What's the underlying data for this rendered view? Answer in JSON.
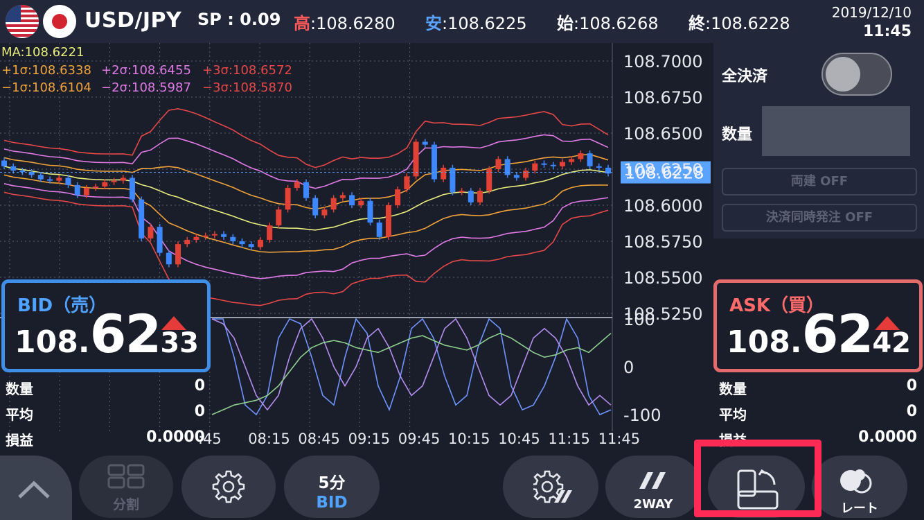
{
  "header": {
    "pair": "USD/JPY",
    "spread": "SP : 0.09",
    "high_key": "高",
    "high_val": ":108.6280",
    "low_key": "安",
    "low_val": ":108.6225",
    "open_key": "始",
    "open_val": ":108.6268",
    "close_key": "終",
    "close_val": ":108.6228",
    "date": "2019/12/10",
    "time": "11:45"
  },
  "chart": {
    "ma_label": "MA:108.6221",
    "sigma_p1": "+1σ:108.6338",
    "sigma_p2": "+2σ:108.6455",
    "sigma_p3": "+3σ:108.6572",
    "sigma_m1": "−1σ:108.6104",
    "sigma_m2": "−2σ:108.5987",
    "sigma_m3": "−3σ:108.5870",
    "current_price_label": "108.6228",
    "colors": {
      "ma": "#e8ef7d",
      "sigma1": "#f0a33a",
      "sigma2": "#e07be6",
      "sigma3": "#e64848",
      "up_candle": "#e24236",
      "down_candle": "#3e88ff",
      "current_price_bg": "#5aa3ff"
    }
  },
  "chart_data": [
    {
      "type": "candlestick",
      "xlabel": "",
      "ylabel": "",
      "ylim": [
        108.52,
        108.705
      ],
      "y_ticks": [
        "108.7000",
        "108.6750",
        "108.6500",
        "108.6250",
        "108.6000",
        "108.5750",
        "108.5500",
        "108.5250"
      ],
      "x_ticks": [
        ":45",
        "08:15",
        "08:45",
        "09:15",
        "09:45",
        "10:15",
        "10:45",
        "11:15",
        "11:45"
      ],
      "indicators": [
        "MA",
        "+1σ",
        "+2σ",
        "+3σ",
        "−1σ",
        "−2σ",
        "−3σ"
      ],
      "close": [
        108.627,
        108.624,
        108.623,
        108.621,
        108.618,
        108.617,
        108.619,
        108.614,
        108.607,
        108.612,
        108.613,
        108.616,
        108.617,
        108.619,
        108.604,
        108.577,
        108.585,
        108.567,
        108.559,
        108.573,
        108.576,
        108.578,
        108.579,
        108.58,
        108.578,
        108.575,
        108.573,
        108.571,
        108.576,
        108.586,
        108.597,
        108.612,
        108.616,
        108.605,
        108.593,
        108.597,
        108.605,
        108.607,
        108.6,
        108.603,
        108.588,
        108.578,
        108.6,
        108.611,
        108.62,
        108.644,
        108.642,
        108.618,
        108.626,
        108.609,
        108.61,
        108.602,
        108.61,
        108.625,
        108.632,
        108.621,
        108.619,
        108.624,
        108.629,
        108.628,
        108.627,
        108.63,
        108.632,
        108.636,
        108.627,
        108.626,
        108.622
      ]
    },
    {
      "type": "line",
      "title": "",
      "ylim": [
        -100,
        100
      ],
      "y_ticks": [
        "100",
        "0",
        "-100"
      ],
      "series": [
        {
          "values": [
            100,
            100,
            20,
            -80,
            -100,
            -60,
            60,
            100,
            90,
            20,
            -60,
            -80,
            20,
            100,
            70,
            -40,
            -90,
            -20,
            80,
            100,
            60,
            -20,
            -80,
            -60,
            40,
            100,
            80,
            -40,
            -90,
            -80,
            -40,
            20,
            100,
            60,
            -60,
            -100,
            -90
          ]
        },
        {
          "values": [
            100,
            90,
            60,
            0,
            -60,
            -90,
            -60,
            20,
            80,
            100,
            60,
            0,
            -40,
            0,
            60,
            80,
            40,
            -20,
            -60,
            -40,
            20,
            80,
            100,
            60,
            0,
            -60,
            -80,
            -60,
            0,
            60,
            80,
            60,
            20,
            -40,
            -80,
            -60,
            -80
          ]
        },
        {
          "values": [
            -100,
            -90,
            -80,
            -75,
            -70,
            -60,
            -40,
            -10,
            20,
            40,
            50,
            55,
            50,
            40,
            35,
            30,
            40,
            50,
            60,
            65,
            55,
            45,
            40,
            35,
            45,
            60,
            70,
            60,
            45,
            30,
            20,
            25,
            35,
            40,
            30,
            50,
            70
          ]
        }
      ]
    }
  ],
  "right_panel": {
    "all_settle_label": "全決済",
    "all_settle_toggle": "off",
    "qty_label": "数量",
    "qty_value": "",
    "ryodate_button": "両建 OFF",
    "settle_order_button": "決済同時発注 OFF"
  },
  "bid": {
    "title": "BID（売）",
    "price_small": "108.",
    "price_big": "62",
    "price_tail": "33",
    "direction": "up",
    "qty_label": "数量",
    "qty_value": "0",
    "avg_label": "平均",
    "avg_value": "0",
    "pl_label": "損益",
    "pl_value": "0.0000"
  },
  "ask": {
    "title": "ASK（買）",
    "price_small": "108.",
    "price_big": "62",
    "price_tail": "42",
    "direction": "up",
    "qty_label": "数量",
    "qty_value": "0",
    "avg_label": "平均",
    "avg_value": "0",
    "pl_label": "損益",
    "pl_value": "0.0000"
  },
  "bottom_bar": {
    "collapse_icon": "chevron-up-icon",
    "split_label": "分割",
    "settings_icon": "gear-icon",
    "timeframe_top": "5分",
    "timeframe_bottom": "BID",
    "chart_settings_icon": "gear-slash-icon",
    "twoway_label": "2WAY",
    "rotate_icon": "rotate-layout-icon",
    "rate_label": "レート"
  }
}
